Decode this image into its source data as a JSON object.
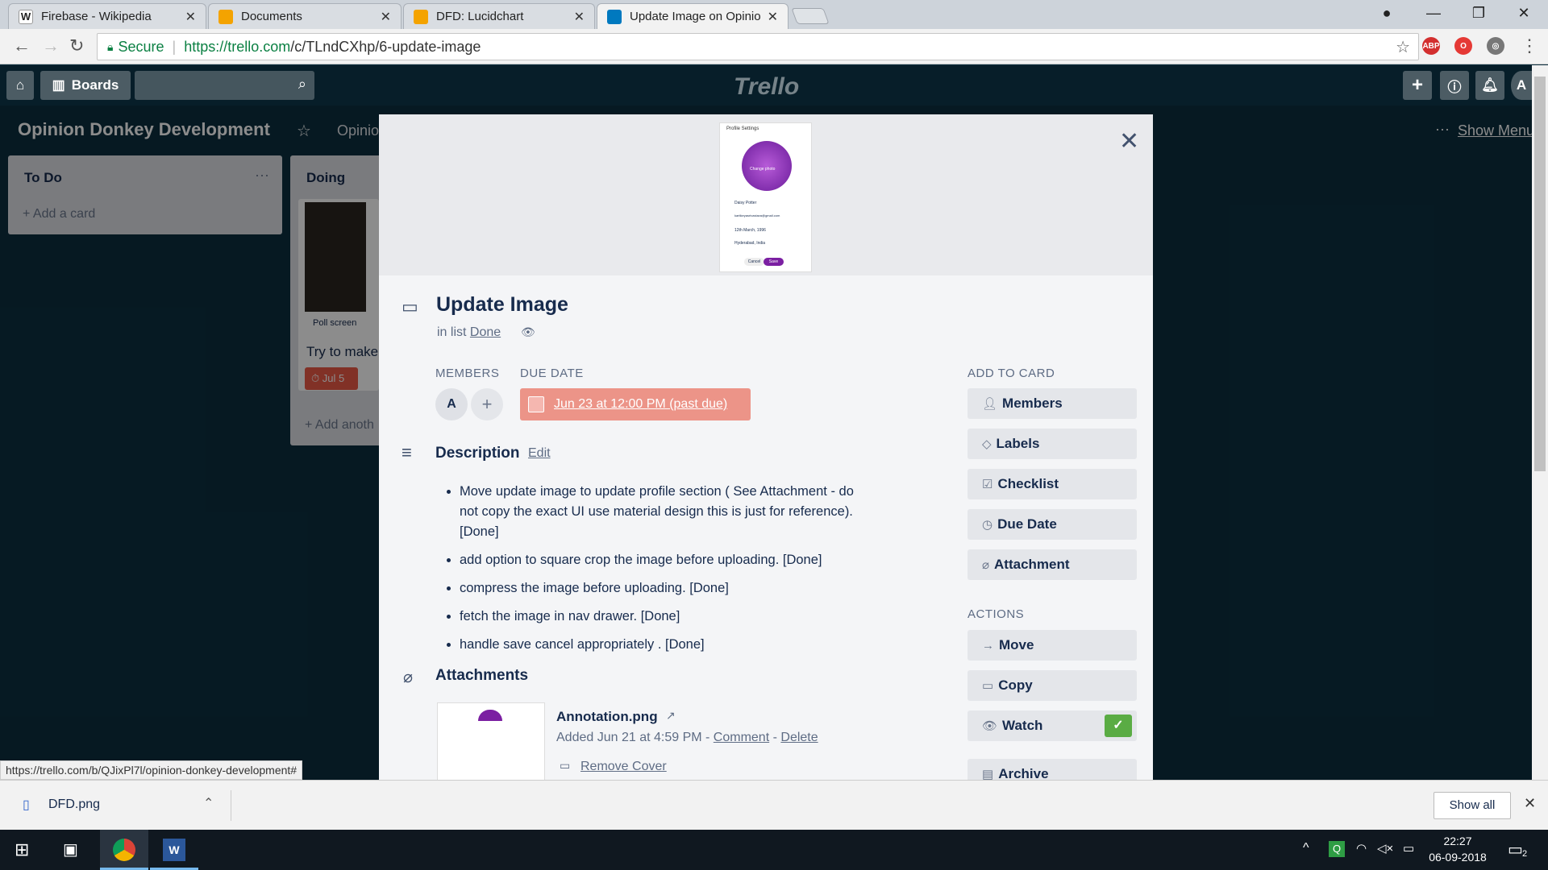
{
  "browser": {
    "tabs": [
      {
        "title": "Firebase - Wikipedia",
        "icon": "wikipedia-icon"
      },
      {
        "title": "Documents",
        "icon": "drive-icon"
      },
      {
        "title": "DFD: Lucidchart",
        "icon": "lucidchart-icon"
      },
      {
        "title": "Update Image on Opinio",
        "icon": "trello-icon"
      }
    ],
    "secure_label": "Secure",
    "url_host": "https://trello.com",
    "url_path": "/c/TLndCXhp/6-update-image",
    "extensions": [
      "ABP"
    ]
  },
  "trello": {
    "boards_label": "Boards",
    "logo": "Trello",
    "board_title": "Opinion Donkey Development",
    "board_team": "Opinio",
    "show_menu": "Show Menu",
    "lists": [
      {
        "title": "To Do",
        "add": "+ Add a card"
      },
      {
        "title": "Doing",
        "card_caption": "Poll screen",
        "card_text": "Try to make",
        "badge": "Jul 5",
        "add": "+ Add anoth"
      }
    ]
  },
  "card": {
    "title": "Update Image",
    "in_list_prefix": "in list",
    "list_name": "Done",
    "members_label": "MEMBERS",
    "member_initial": "A",
    "due_label": "DUE DATE",
    "due_value": "Jun 23 at 12:00 PM (past due)",
    "description_label": "Description",
    "edit_label": "Edit",
    "description_items": [
      "Move update image to update profile section ( See Attachment - do not copy the exact UI use material design this is just for reference). [Done]",
      "add option to square crop the image before uploading. [Done]",
      "compress the image before uploading. [Done]",
      "fetch the image in nav drawer. [Done]",
      "handle save cancel appropriately . [Done]"
    ],
    "attachments_label": "Attachments",
    "attachment": {
      "name": "Annotation.png",
      "added": "Added Jun 21 at 4:59 PM -",
      "comment": "Comment",
      "dash": "-",
      "delete": "Delete",
      "remove_cover": "Remove Cover"
    },
    "cover_preview": {
      "header": "Profile Settings",
      "change_photo": "Change photo",
      "fields": [
        "Daisy Potter",
        "kartikeyasrivastava@gmail.com",
        "12th March, 1996",
        "Hyderabad, India"
      ],
      "cancel": "Cancel",
      "save": "Save"
    },
    "add_to_card_label": "ADD TO CARD",
    "add_buttons": [
      "Members",
      "Labels",
      "Checklist",
      "Due Date",
      "Attachment"
    ],
    "actions_label": "ACTIONS",
    "action_buttons": [
      "Move",
      "Copy",
      "Watch",
      "Archive"
    ]
  },
  "status_url": "https://trello.com/b/QJixPl7l/opinion-donkey-development#",
  "downloads": {
    "file": "DFD.png",
    "show_all": "Show all"
  },
  "taskbar": {
    "time": "22:27",
    "date": "06-09-2018",
    "notifications": "2"
  },
  "colors": {
    "due_bg": "#ec9488",
    "watch_check": "#5aac44",
    "header_overlay": "#0b2f3f"
  }
}
